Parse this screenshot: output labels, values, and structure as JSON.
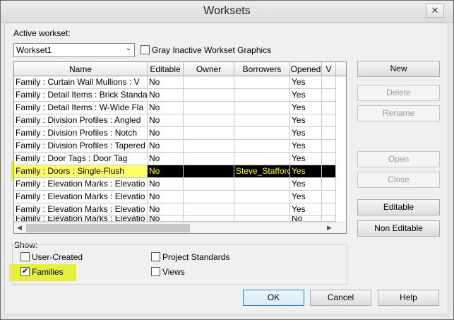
{
  "window": {
    "title": "Worksets",
    "close_glyph": "✕"
  },
  "active_workset": {
    "label": "Active workset:",
    "value": "Workset1"
  },
  "gray_inactive": {
    "label": "Gray Inactive Workset Graphics",
    "checked": false
  },
  "table": {
    "columns": [
      "Name",
      "Editable",
      "Owner",
      "Borrowers",
      "Opened",
      "V"
    ],
    "rows": [
      {
        "name": "Family : Curtain Wall Mullions : V",
        "editable": "No",
        "owner": "",
        "borrowers": "",
        "opened": "Yes"
      },
      {
        "name": "Family : Detail Items : Brick Standa",
        "editable": "No",
        "owner": "",
        "borrowers": "",
        "opened": "Yes"
      },
      {
        "name": "Family : Detail Items : W-Wide Fla",
        "editable": "No",
        "owner": "",
        "borrowers": "",
        "opened": "Yes"
      },
      {
        "name": "Family : Division Profiles : Angled",
        "editable": "No",
        "owner": "",
        "borrowers": "",
        "opened": "Yes"
      },
      {
        "name": "Family : Division Profiles : Notch",
        "editable": "No",
        "owner": "",
        "borrowers": "",
        "opened": "Yes"
      },
      {
        "name": "Family : Division Profiles : Tapered",
        "editable": "No",
        "owner": "",
        "borrowers": "",
        "opened": "Yes"
      },
      {
        "name": "Family : Door Tags : Door Tag",
        "editable": "No",
        "owner": "",
        "borrowers": "",
        "opened": "Yes"
      },
      {
        "name": "Family : Doors : Single-Flush",
        "editable": "No",
        "owner": "",
        "borrowers": "Steve_Stafford",
        "opened": "Yes"
      },
      {
        "name": "Family : Elevation Marks : Elevatio",
        "editable": "No",
        "owner": "",
        "borrowers": "",
        "opened": "Yes"
      },
      {
        "name": "Family : Elevation Marks : Elevatio",
        "editable": "No",
        "owner": "",
        "borrowers": "",
        "opened": "Yes"
      },
      {
        "name": "Family : Elevation Marks : Elevatio",
        "editable": "No",
        "owner": "",
        "borrowers": "",
        "opened": "Yes"
      },
      {
        "name": "Family : Elevation Marks : Elevatio",
        "editable": "No",
        "owner": "",
        "borrowers": "",
        "opened": "No"
      }
    ],
    "selected_row_index": 7
  },
  "buttons": {
    "new": "New",
    "delete": "Delete",
    "rename": "Rename",
    "open": "Open",
    "close": "Close",
    "editable": "Editable",
    "non_editable": "Non Editable",
    "ok": "OK",
    "cancel": "Cancel",
    "help": "Help"
  },
  "show": {
    "label": "Show:",
    "user_created": {
      "label": "User-Created",
      "checked": false
    },
    "families": {
      "label": "Families",
      "checked": true
    },
    "project_standards": {
      "label": "Project Standards",
      "checked": false
    },
    "views": {
      "label": "Views",
      "checked": false
    }
  },
  "colors": {
    "highlight": "#e6f028",
    "selected_row_bg": "#000000",
    "selected_row_text": "#ffff00"
  },
  "icons": {
    "check_glyph": "✔",
    "dropdown": "chevron-down-icon",
    "scroll_up": "▲",
    "scroll_down": "▼",
    "scroll_left": "◀",
    "scroll_right": "▶",
    "combo_arrow": "⌄"
  }
}
